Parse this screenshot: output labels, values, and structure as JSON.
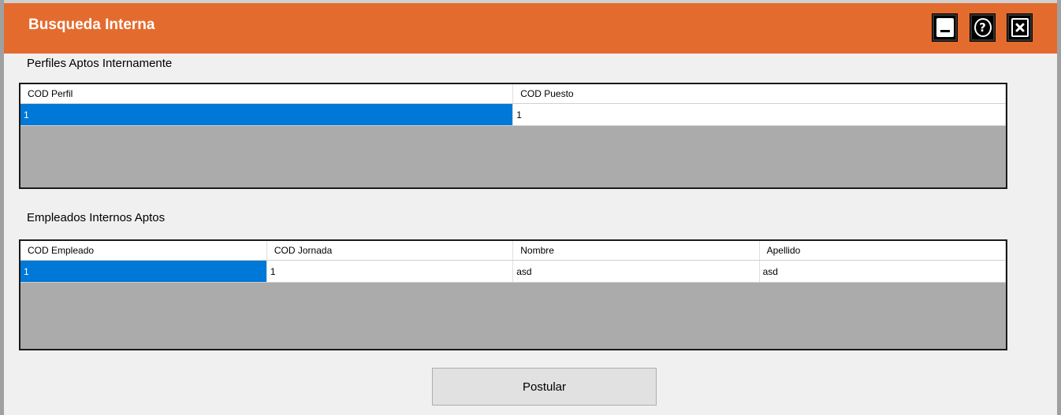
{
  "window": {
    "title": "Busqueda Interna",
    "controls": [
      {
        "name": "minimize",
        "icon": "minimize-icon"
      },
      {
        "name": "help",
        "icon": "help-icon"
      },
      {
        "name": "close",
        "icon": "close-icon"
      }
    ],
    "accent_color": "#e46b2e"
  },
  "perfiles": {
    "label": "Perfiles Aptos Internamente",
    "columns": [
      "COD Perfil",
      "COD Puesto"
    ],
    "rows": [
      [
        "1",
        "1"
      ]
    ]
  },
  "empleados": {
    "label": "Empleados Internos Aptos",
    "columns": [
      "COD Empleado",
      "COD Jornada",
      "Nombre",
      "Apellido"
    ],
    "rows": [
      [
        "1",
        "1",
        "asd",
        "asd"
      ]
    ]
  },
  "actions": {
    "postular_label": "Postular"
  }
}
